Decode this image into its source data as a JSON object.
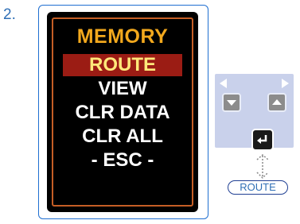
{
  "step_number": "2.",
  "menu": {
    "title": "MEMORY",
    "items": [
      "ROUTE",
      "VIEW",
      "CLR DATA",
      "CLR ALL",
      "- ESC -"
    ],
    "selected_index": 0
  },
  "controls": {
    "left_arrow_icon": "triangle-left-icon",
    "right_arrow_icon": "triangle-right-icon",
    "down_button_icon": "triangle-down-icon",
    "up_button_icon": "triangle-up-icon",
    "enter_button_icon": "enter-return-icon",
    "button_label": "ROUTE"
  },
  "colors": {
    "title": "#f2a81d",
    "selected_bg": "#9b1c14",
    "selected_text": "#ffe87a",
    "frame": "#1f6fd1",
    "panel": "#c9d1eb"
  }
}
